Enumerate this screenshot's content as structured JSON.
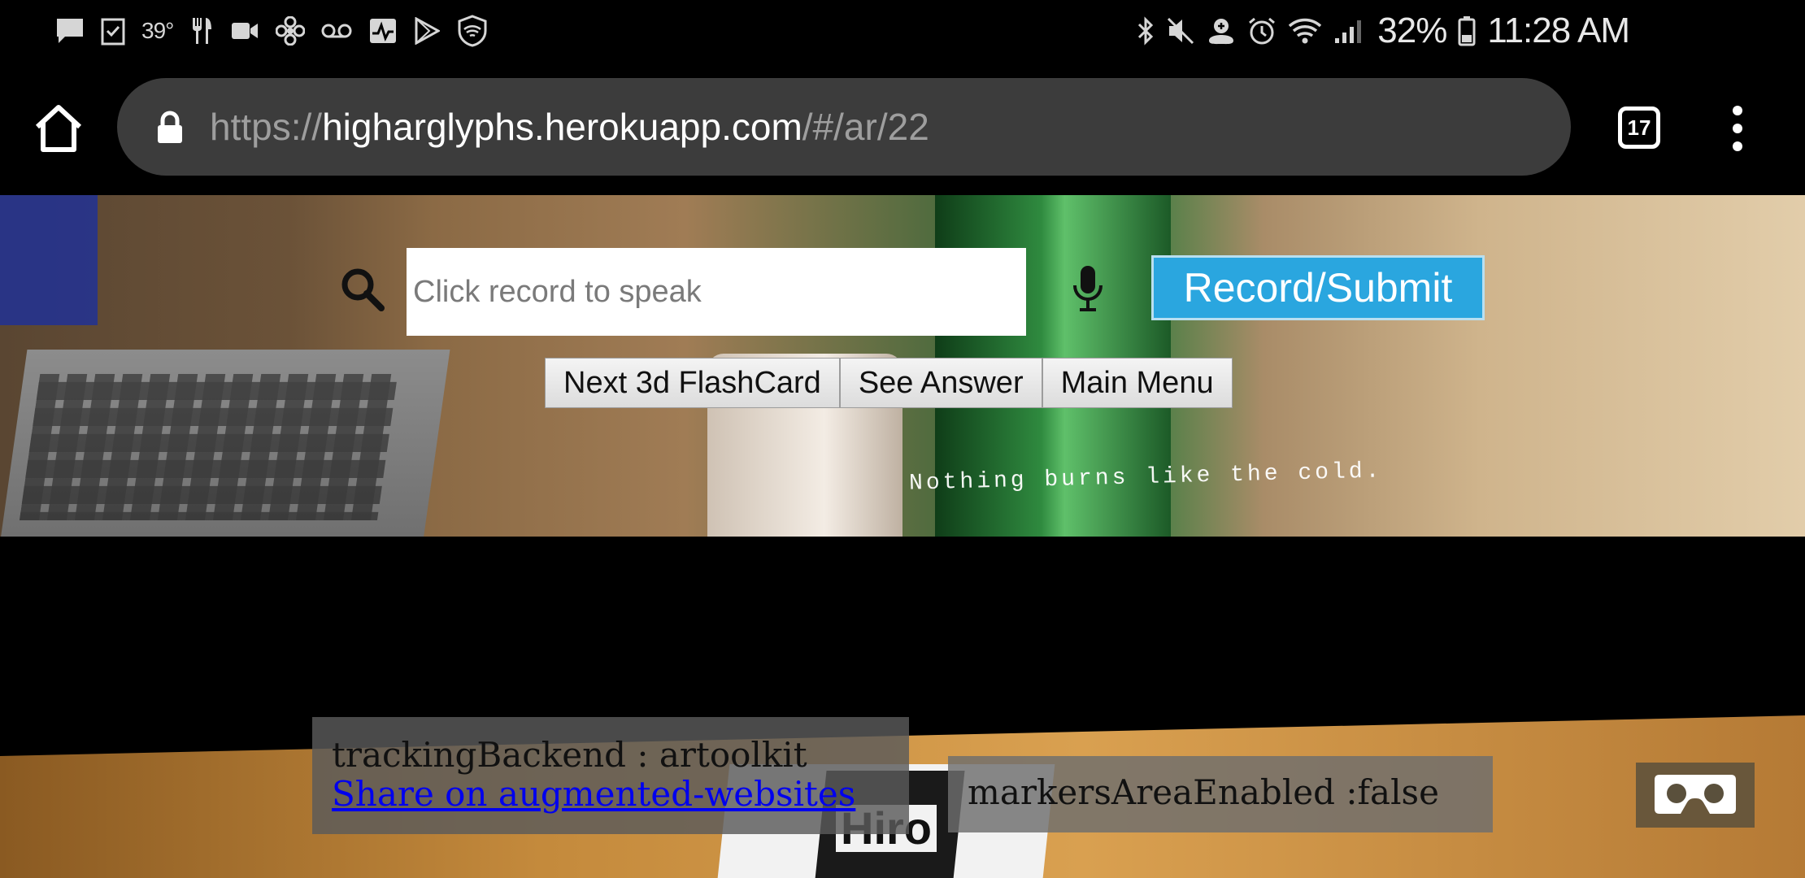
{
  "status_bar": {
    "left_icons": [
      "message-icon",
      "task-icon",
      "temperature",
      "restaurant-icon",
      "video-call-icon",
      "fan-icon",
      "voicemail-icon",
      "health-icon",
      "play-store-icon",
      "wifi-shield-icon"
    ],
    "temperature": "39°",
    "right_icons": [
      "bluetooth-icon",
      "mute-icon",
      "location-icon",
      "alarm-icon",
      "wifi-icon",
      "signal-icon",
      "battery-icon"
    ],
    "battery_percent": "32%",
    "time": "11:28 AM"
  },
  "browser": {
    "url_scheme": "https://",
    "url_host": "higharglyphs.herokuapp.com",
    "url_path": "/#/ar/22",
    "tab_count": "17"
  },
  "page": {
    "speech_placeholder": "Click record to speak",
    "record_button": "Record/Submit",
    "buttons": [
      "Next 3d FlashCard",
      "See Answer",
      "Main Menu"
    ],
    "ar_caption": "Nothing burns like the cold.",
    "tracking_backend": "trackingBackend : artoolkit",
    "share_link": "Share on augmented-websites",
    "markers_area": "markersAreaEnabled :false",
    "marker_label": "Hiro"
  },
  "colors": {
    "record_button_bg": "#2aa6df",
    "url_bar_bg": "#3c3c3c",
    "link": "#0000ee"
  }
}
